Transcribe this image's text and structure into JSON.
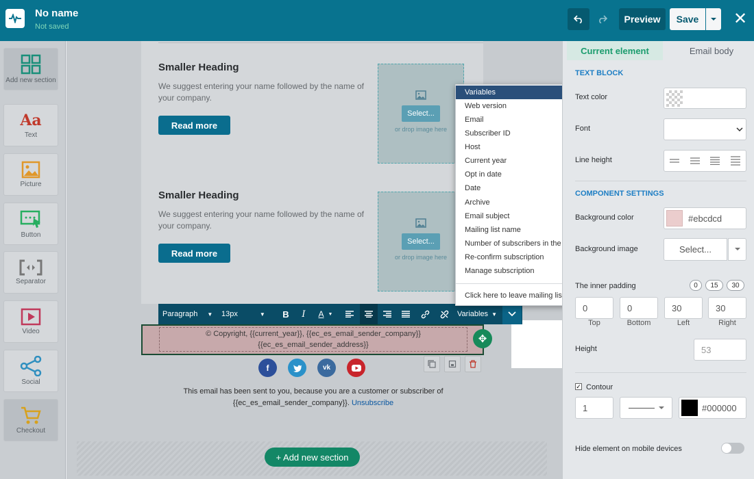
{
  "header": {
    "title": "No name",
    "subtitle": "Not saved",
    "preview_label": "Preview",
    "save_label": "Save"
  },
  "sidebar": {
    "items": [
      {
        "label": "Add new section",
        "icon": "grid-icon"
      },
      {
        "label": "Text",
        "icon": "text-icon"
      },
      {
        "label": "Picture",
        "icon": "picture-icon"
      },
      {
        "label": "Button",
        "icon": "button-icon"
      },
      {
        "label": "Separator",
        "icon": "separator-icon"
      },
      {
        "label": "Video",
        "icon": "video-icon"
      },
      {
        "label": "Social",
        "icon": "share-icon"
      },
      {
        "label": "Checkout",
        "icon": "cart-icon"
      }
    ]
  },
  "content": {
    "blocks": [
      {
        "heading": "Smaller Heading",
        "text": "We suggest entering your name followed by the name of your company.",
        "button": "Read more",
        "select": "Select...",
        "drop": "or drop image here"
      },
      {
        "heading": "Smaller Heading",
        "text": "We suggest entering your name followed by the name of your company.",
        "button": "Read more",
        "select": "Select...",
        "drop": "or drop image here"
      }
    ],
    "footer_line1": "© Copyright, {{current_year}}, {{ec_es_email_sender_company}} ",
    "footer_line2": "{{ec_es_email_sender_address}}",
    "legal_line1": "This email has been sent to you, because you are a customer or subscriber of",
    "legal_line2": "{{ec_es_email_sender_company}}.",
    "unsubscribe": "Unsubscribe",
    "add_section": "+ Add new section"
  },
  "text_toolbar": {
    "paragraph": "Paragraph",
    "font_size": "13px",
    "bold": "B",
    "italic": "I",
    "variables": "Variables"
  },
  "variables_menu": {
    "items": [
      "Variables",
      "Web version",
      "Email",
      "Subscriber ID",
      "Host",
      "Current year",
      "Opt in date",
      "Date",
      "Archive",
      "Email subject",
      "Mailing list name",
      "Number of subscribers in the list",
      "Re-confirm subscription",
      "Manage subscription"
    ],
    "footer_item": "Click here to leave mailing list"
  },
  "right_panel": {
    "tab_current": "Current element",
    "tab_body": "Email body",
    "text_block_title": "TEXT BLOCK",
    "text_color_label": "Text color",
    "font_label": "Font",
    "line_height_label": "Line height",
    "component_title": "COMPONENT SETTINGS",
    "bg_color_label": "Background color",
    "bg_color_value": "#ebcdcd",
    "bg_image_label": "Background image",
    "bg_image_btn": "Select...",
    "inner_padding_label": "The inner padding",
    "padding_presets": [
      "0",
      "15",
      "30"
    ],
    "padding": {
      "top": "0",
      "bottom": "0",
      "left": "30",
      "right": "30"
    },
    "padding_labels": {
      "top": "Top",
      "bottom": "Bottom",
      "left": "Left",
      "right": "Right"
    },
    "height_label": "Height",
    "height_value": "53",
    "contour_label": "Contour",
    "contour_width": "1",
    "contour_color": "#000000",
    "hide_mobile_label": "Hide element on mobile devices"
  },
  "colors": {
    "topbar": "#08738f",
    "accent_green": "#1a9c6d",
    "button_blue": "#0a6d8e"
  }
}
